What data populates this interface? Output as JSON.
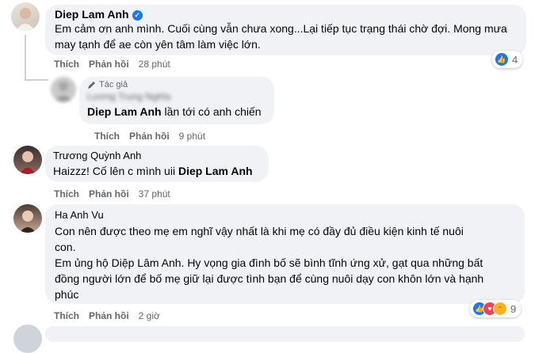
{
  "actions": {
    "like": "Thích",
    "reply": "Phản hồi"
  },
  "comment1": {
    "author": "Diep Lam Anh",
    "text": "Em cảm ơn anh mình. Cuối cùng vẫn chưa xong...Lại tiếp tục trạng thái chờ đợi. Mong mưa may tạnh để ae còn yên tâm làm việc lớn.",
    "time": "28 phút",
    "reaction_count": "4"
  },
  "reply1": {
    "tag": "Tác giả",
    "author_blurred": "Lương Trung Nghĩa",
    "mention": "Diep Lam Anh",
    "text": " lần tới có anh chiến",
    "time": "9 phút"
  },
  "comment2": {
    "author": "Trương Quỳnh Anh",
    "text": "Haizzz! Cố lên c mình uii ",
    "mention": "Diep Lam Anh",
    "time": "37 phút"
  },
  "comment3": {
    "author": "Ha Anh Vu",
    "text_line1": "Con nên được theo mẹ em nghĩ vậy nhất là khi mẹ có đầy đủ điều kiện kinh tế nuôi",
    "text_line2": "con.",
    "text_line3": "Em ủng hộ Diệp Lâm Anh. Hy vọng gia đình bố sẽ bình tĩnh ứng xử, gạt qua những bất",
    "text_line4": "đồng người lớn để bố mẹ giữ lại được tình bạn để cùng nuôi dạy con khôn lớn và hạnh",
    "text_line5": "phúc",
    "time": "2 giờ",
    "reaction_count": "9"
  },
  "colors": {
    "like": "#1877f2",
    "love": "#f33e58",
    "haha": "#f7b125",
    "bubble": "#f0f2f5",
    "meta": "#65676b"
  }
}
